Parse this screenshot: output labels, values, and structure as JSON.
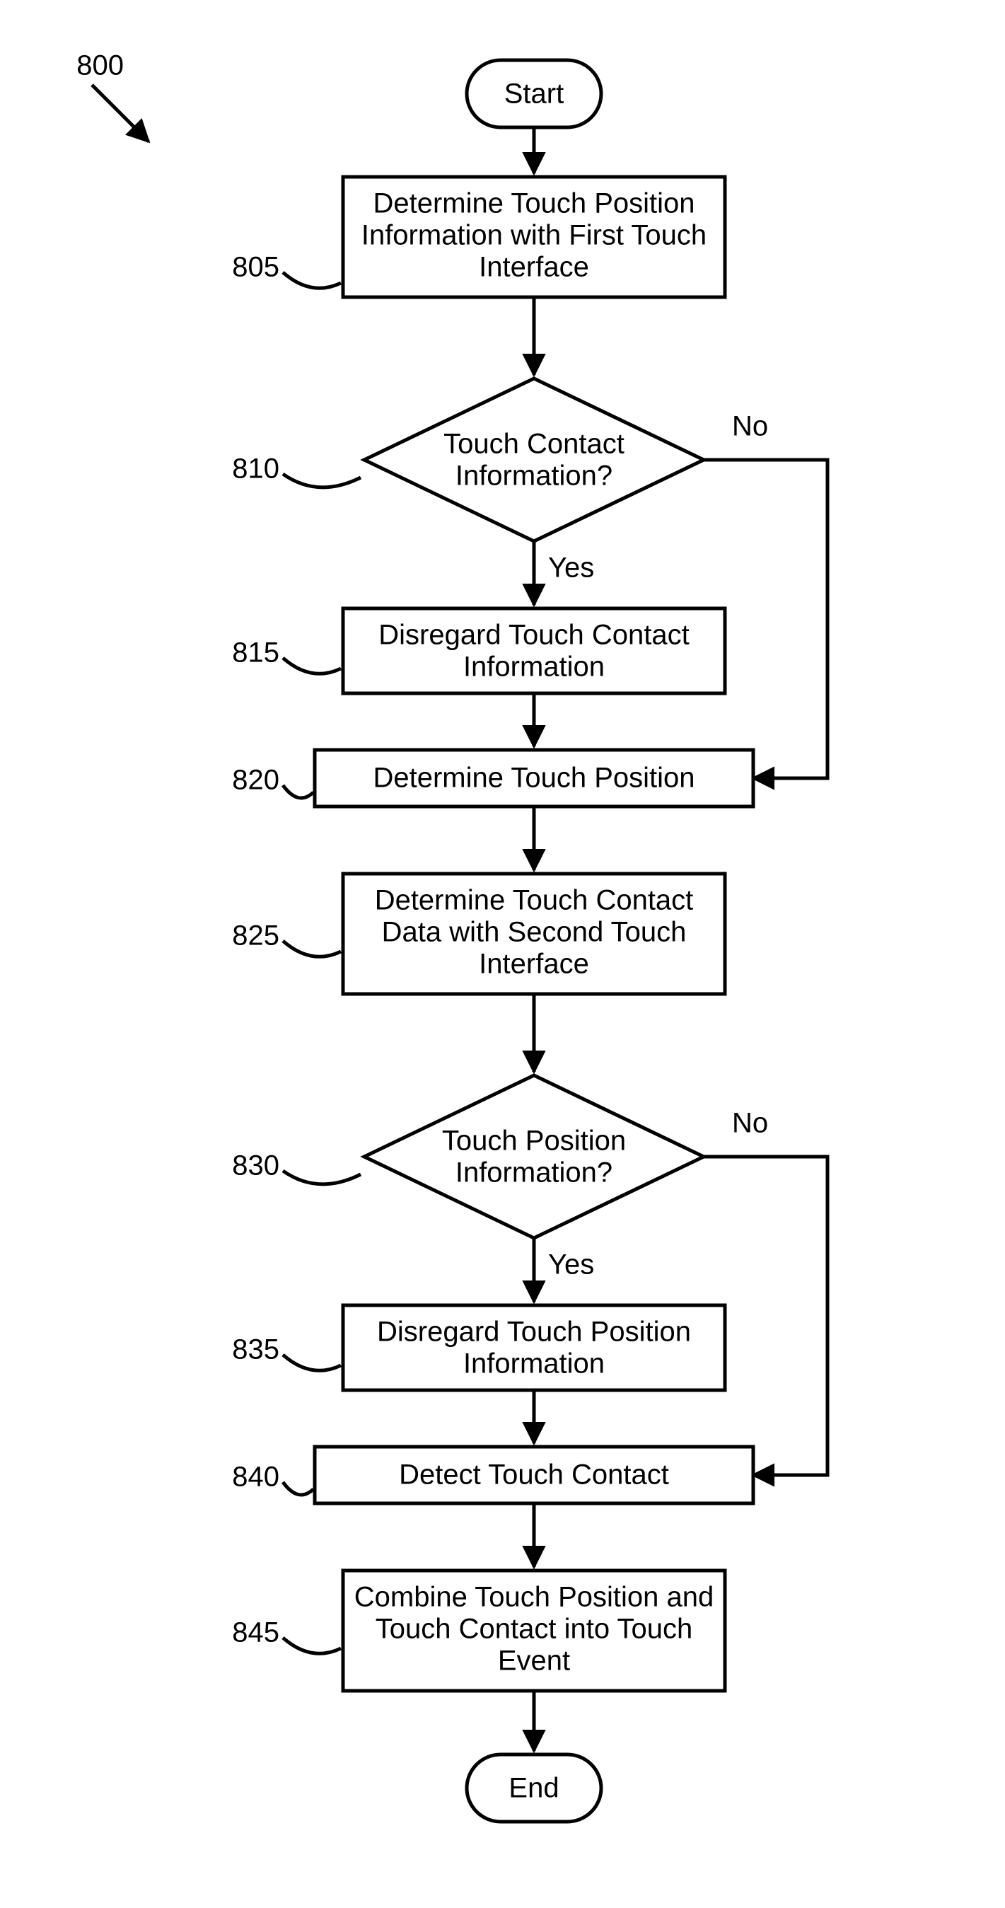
{
  "title_ref": "800",
  "nodes": {
    "start": {
      "text": "Start"
    },
    "end": {
      "text": "End"
    },
    "n805": {
      "ref": "805",
      "l1": "Determine Touch Position",
      "l2": "Information with First Touch",
      "l3": "Interface"
    },
    "n810": {
      "ref": "810",
      "l1": "Touch Contact",
      "l2": "Information?"
    },
    "n815": {
      "ref": "815",
      "l1": "Disregard Touch Contact",
      "l2": "Information"
    },
    "n820": {
      "ref": "820",
      "l1": "Determine Touch Position"
    },
    "n825": {
      "ref": "825",
      "l1": "Determine Touch Contact",
      "l2": "Data with Second Touch",
      "l3": "Interface"
    },
    "n830": {
      "ref": "830",
      "l1": "Touch Position",
      "l2": "Information?"
    },
    "n835": {
      "ref": "835",
      "l1": "Disregard Touch Position",
      "l2": "Information"
    },
    "n840": {
      "ref": "840",
      "l1": "Detect Touch Contact"
    },
    "n845": {
      "ref": "845",
      "l1": "Combine Touch Position and",
      "l2": "Touch Contact into Touch",
      "l3": "Event"
    }
  },
  "labels": {
    "yes": "Yes",
    "no": "No"
  }
}
